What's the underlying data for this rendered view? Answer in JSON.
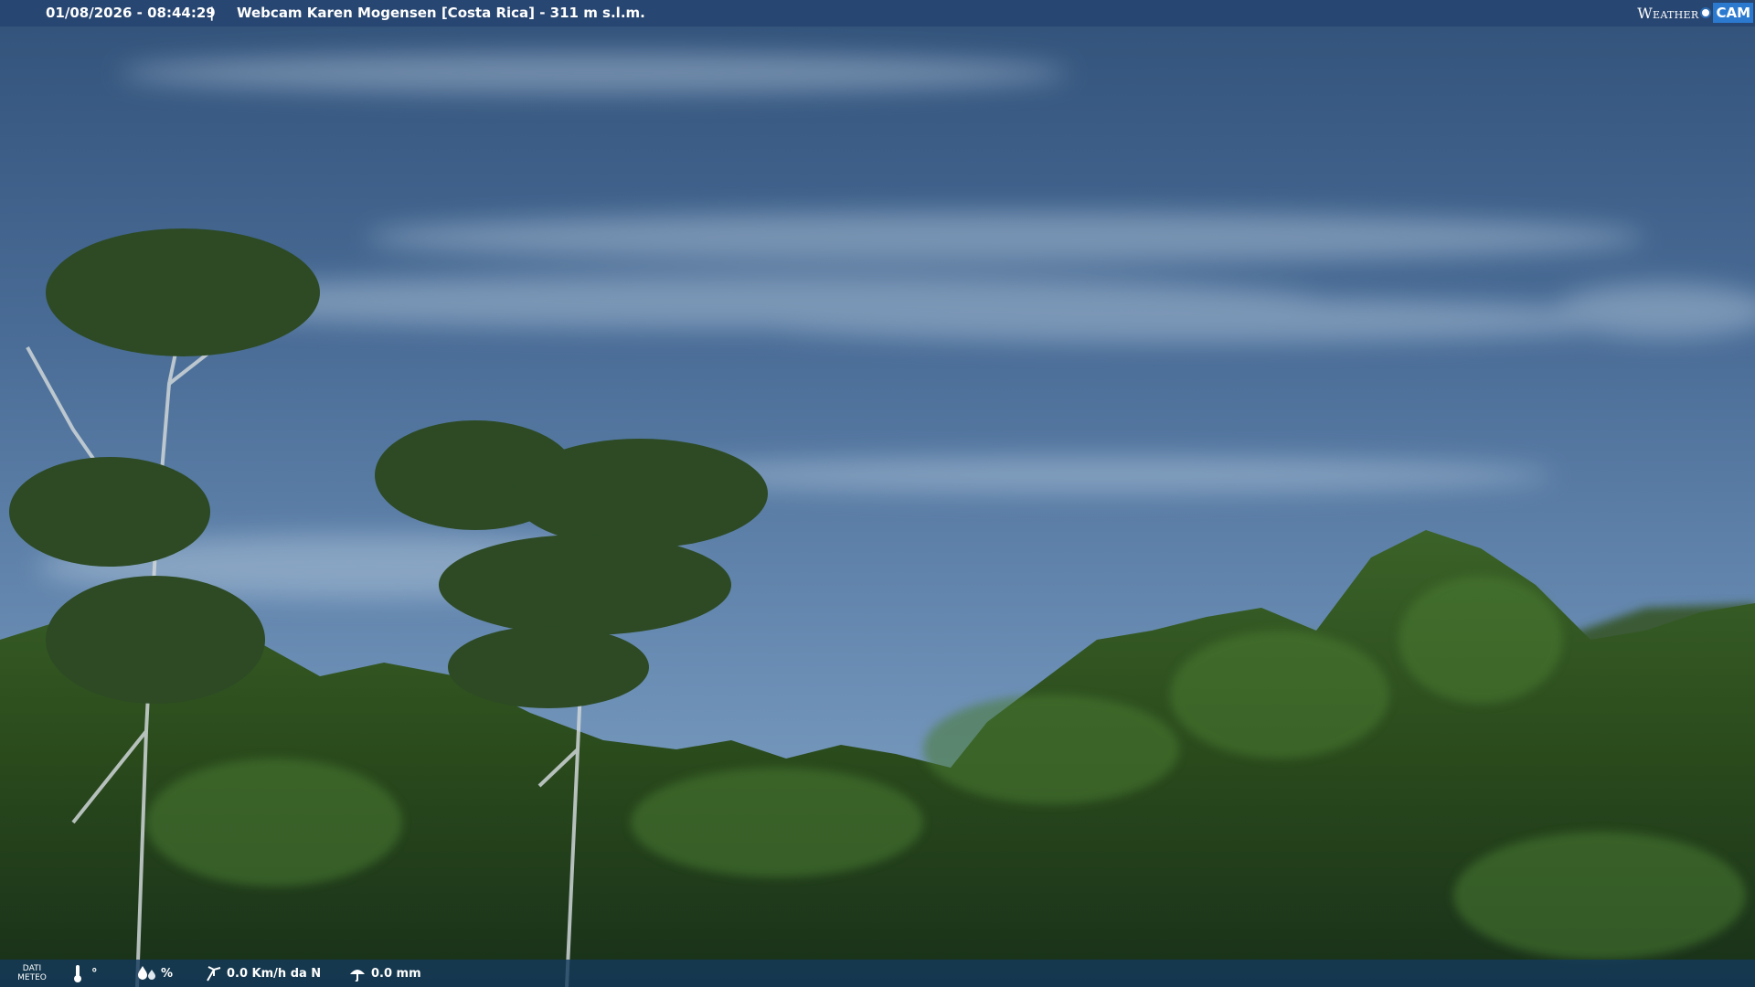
{
  "header": {
    "datetime": "01/08/2026 - 08:44:29",
    "separator": "|",
    "title": "Webcam Karen Mogensen [Costa Rica] - 311 m s.l.m."
  },
  "brand": {
    "weather": "Weather",
    "cam": "CAM"
  },
  "meteo": {
    "label_line1": "DATI",
    "label_line2": "METEO",
    "temperature": "°",
    "humidity": "%",
    "wind": "0.0 Km/h da N",
    "rain": "0.0 mm"
  },
  "colors": {
    "bar": "#264470",
    "sky": "#3d5e86",
    "foliage": "#2a4a1c"
  }
}
